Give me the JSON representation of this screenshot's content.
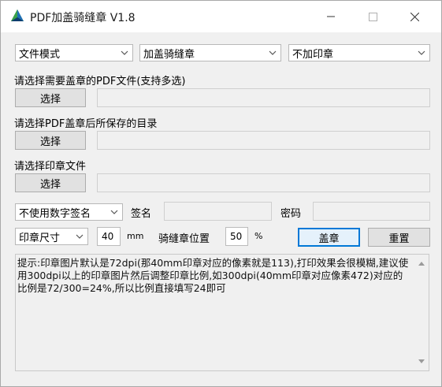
{
  "window": {
    "title": "PDF加盖骑缝章 V1.8"
  },
  "mode_row": {
    "file_mode": "文件模式",
    "seam_mode": "加盖骑缝章",
    "stamp_mode": "不加印章"
  },
  "pdf_files": {
    "label": "请选择需要盖章的PDF文件(支持多选)",
    "button": "选择",
    "value": ""
  },
  "output_dir": {
    "label": "请选择PDF盖章后所保存的目录",
    "button": "选择",
    "value": ""
  },
  "stamp_file": {
    "label": "请选择印章文件",
    "button": "选择",
    "value": ""
  },
  "signature": {
    "mode": "不使用数字签名",
    "sign_label": "签名",
    "sign_value": "",
    "password_label": "密码",
    "password_value": ""
  },
  "settings": {
    "size_mode": "印章尺寸",
    "size_value": "40",
    "size_unit": "mm",
    "position_label": "骑缝章位置",
    "position_value": "50",
    "position_unit": "%",
    "stamp_button": "盖章",
    "reset_button": "重置"
  },
  "tip": "提示:印章图片默认是72dpi(那40mm印章对应的像素就是113),打印效果会很模糊,建议使用300dpi以上的印章图片然后调整印章比例,如300dpi(40mm印章对应像素472)对应的比例是72/300=24%,所以比例直接填写24即可"
}
